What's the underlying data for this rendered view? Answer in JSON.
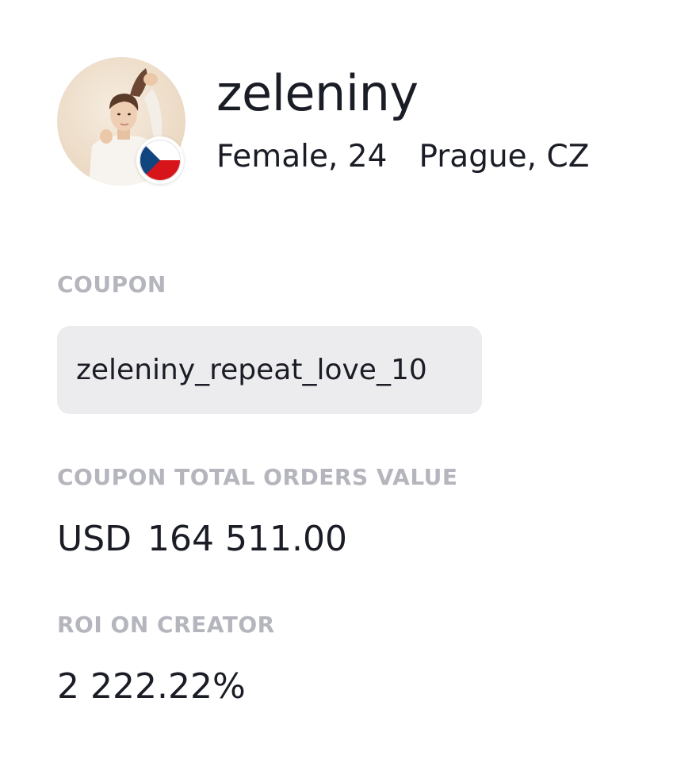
{
  "profile": {
    "username": "zeleniny",
    "gender_age": "Female, 24",
    "location": "Prague, CZ",
    "country_flag": "czech-flag-icon"
  },
  "coupon": {
    "label": "COUPON",
    "code": "zeleniny_repeat_love_10"
  },
  "total_orders": {
    "label": "COUPON TOTAL ORDERS VALUE",
    "currency": "USD",
    "amount": "164 511.00"
  },
  "roi": {
    "label": "ROI ON CREATOR",
    "value": "2 222.22%"
  },
  "colors": {
    "text": "#1b1d26",
    "label": "#b5b6bd",
    "coupon_bg": "#ececee",
    "flag_blue": "#11457e",
    "flag_red": "#d7141a"
  }
}
